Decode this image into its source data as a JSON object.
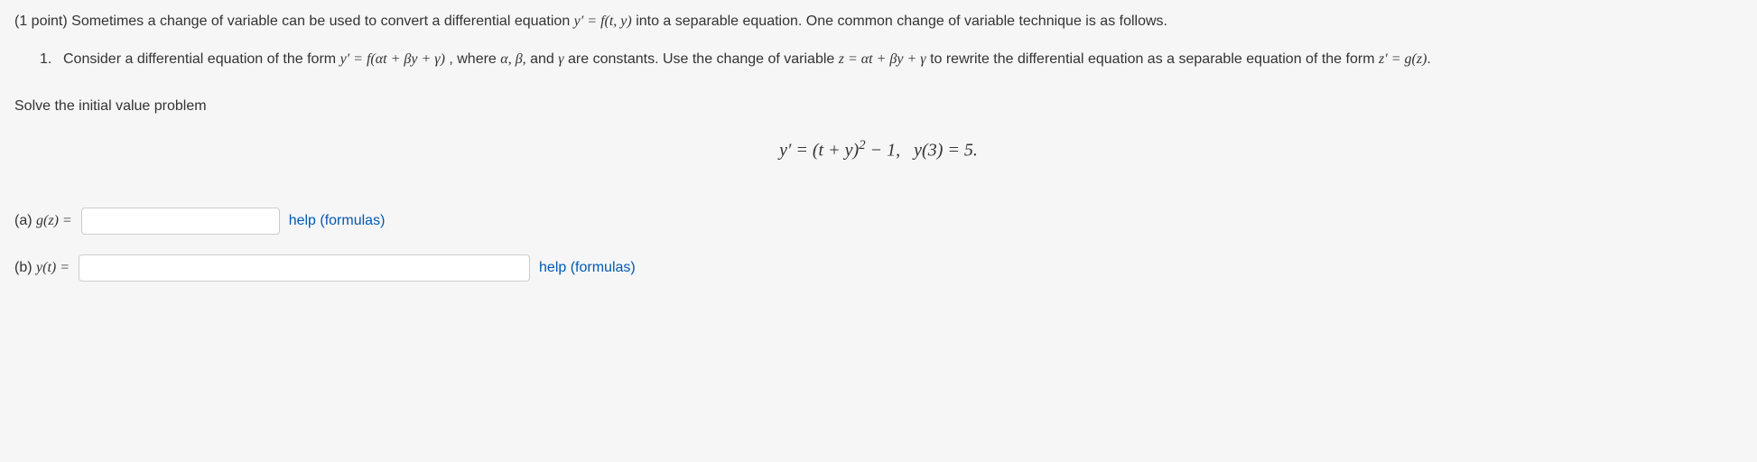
{
  "points": "(1 point)",
  "intro_pre": "Sometimes a change of variable can be used to convert a differential equation ",
  "intro_eq": "y′ = f(t, y)",
  "intro_post": " into a separable equation. One common change of variable technique is as follows.",
  "item1_num": "1.",
  "item1_pre": "Consider a differential equation of the form ",
  "item1_eq1": "y′ = f(αt + βy + γ)",
  "item1_mid1": ", where ",
  "item1_consts": "α, β,",
  "item1_and": " and ",
  "item1_gamma": "γ",
  "item1_mid2": " are constants. Use the change of variable ",
  "item1_eq2": "z = αt + βy + γ",
  "item1_post": " to rewrite the differential equation as a separable equation of the form ",
  "item1_eq3": "z′ = g(z)",
  "item1_end": ".",
  "solve_prompt": "Solve the initial value problem",
  "ivp_equation": "y′ = (t + y)² − 1,   y(3) = 5.",
  "parts": {
    "a": {
      "label_prefix": "(a) ",
      "label_math": "g(z) =",
      "help": "help (formulas)"
    },
    "b": {
      "label_prefix": "(b) ",
      "label_math": "y(t) =",
      "help": "help (formulas)"
    }
  }
}
